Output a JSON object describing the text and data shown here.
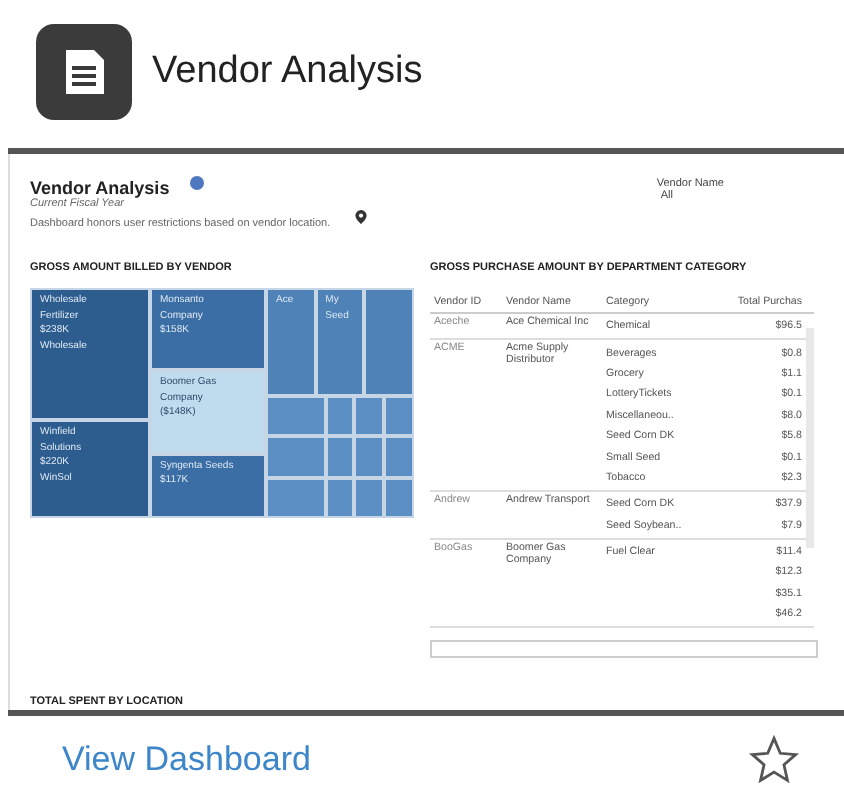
{
  "card": {
    "title": "Vendor Analysis",
    "link": "View Dashboard",
    "favorite": false
  },
  "dashboard": {
    "title": "Vendor Analysis",
    "subtitle": "Current Fiscal Year",
    "note": "Dashboard honors user restrictions based on vendor location.",
    "filter": {
      "label": "Vendor Name",
      "value": "All"
    },
    "treemap": {
      "title": "GROSS AMOUNT BILLED BY VENDOR",
      "tiles": [
        {
          "lines": [
            "Wholesale",
            "Fertilizer",
            "$238K",
            "Wholesale"
          ],
          "selected": false
        },
        {
          "lines": [
            "Winfield",
            "Solutions",
            "$220K",
            "WinSol"
          ],
          "selected": false
        },
        {
          "lines": [
            "Monsanto",
            "Company",
            "$158K"
          ],
          "selected": false
        },
        {
          "lines": [
            "Boomer Gas",
            "Company",
            "($148K)"
          ],
          "selected": true
        },
        {
          "lines": [
            "Syngenta Seeds",
            "$117K"
          ],
          "selected": false
        },
        {
          "lines": [
            "Ace"
          ],
          "selected": false
        },
        {
          "lines": [
            "My",
            "Seed"
          ],
          "selected": false
        }
      ]
    },
    "table": {
      "title": "GROSS PURCHASE AMOUNT BY DEPARTMENT CATEGORY",
      "columns": [
        "Vendor ID",
        "Vendor Name",
        "Category",
        "Total Purchas"
      ],
      "groups": [
        {
          "vendor_id": "Aceche",
          "vendor_name": "Ace Chemical Inc",
          "lines": [
            {
              "category": "Chemical",
              "total": "$96.5"
            }
          ]
        },
        {
          "vendor_id": "ACME",
          "vendor_name": "Acme Supply Distributor",
          "lines": [
            {
              "category": "Beverages",
              "total": "$0.8"
            },
            {
              "category": "Grocery",
              "total": "$1.1"
            },
            {
              "category": "LotteryTickets",
              "total": "$0.1"
            },
            {
              "category": "Miscellaneou..",
              "total": "$8.0"
            },
            {
              "category": "Seed Corn DK",
              "total": "$5.8"
            },
            {
              "category": "Small Seed",
              "total": "$0.1"
            },
            {
              "category": "Tobacco",
              "total": "$2.3"
            }
          ]
        },
        {
          "vendor_id": "Andrew",
          "vendor_name": "Andrew Transport",
          "lines": [
            {
              "category": "Seed Corn DK",
              "total": "$37.9"
            },
            {
              "category": "Seed Soybean..",
              "total": "$7.9"
            }
          ]
        },
        {
          "vendor_id": "BooGas",
          "vendor_name": "Boomer Gas Company",
          "lines": [
            {
              "category": "Fuel Clear",
              "total": "$11.4"
            },
            {
              "total": "$12.3"
            },
            {
              "total": "$35.1"
            },
            {
              "total": "$46.2"
            }
          ]
        }
      ]
    },
    "location": {
      "title": "TOTAL SPENT BY LOCATION"
    }
  }
}
